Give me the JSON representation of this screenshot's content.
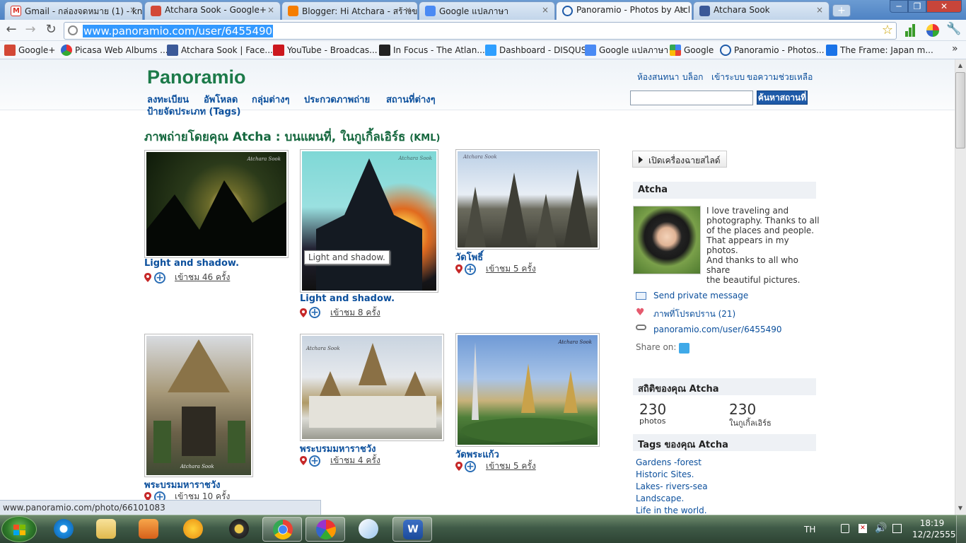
{
  "browser": {
    "tabs": [
      {
        "label": "Gmail - กล่องจดหมาย (1) - kn",
        "icon": "gmail-icon",
        "color": "#d93025"
      },
      {
        "label": "Atchara Sook - Google+",
        "icon": "google-plus-icon",
        "color": "#d34836"
      },
      {
        "label": "Blogger: Hi Atchara - สร้างข",
        "icon": "blogger-icon",
        "color": "#f57d00"
      },
      {
        "label": "Google แปลภาษา",
        "icon": "google-translate-icon",
        "color": "#4a8af4"
      },
      {
        "label": "Panoramio - Photos by Atcl",
        "icon": "panoramio-icon",
        "color": "#1e5aa8"
      },
      {
        "label": "Atchara Sook",
        "icon": "facebook-icon",
        "color": "#3b5998"
      }
    ],
    "close_glyph": "×",
    "new_tab_glyph": "+",
    "window_controls": {
      "minimize": "─",
      "restore": "❐",
      "close": "✕"
    },
    "back_glyph": "←",
    "forward_glyph": "→",
    "reload_glyph": "↻",
    "address": "www.panoramio.com/user/6455490",
    "star_glyph": "☆",
    "wrench_glyph": "🔧",
    "bookmarks": [
      {
        "label": "Google+",
        "icon": "google-plus-icon",
        "color": "#d34836"
      },
      {
        "label": "Picasa Web Albums ...",
        "icon": "picasa-icon",
        "color": "#9b59b6"
      },
      {
        "label": "Atchara Sook | Face...",
        "icon": "facebook-icon",
        "color": "#3b5998"
      },
      {
        "label": "YouTube - Broadcas...",
        "icon": "youtube-icon",
        "color": "#cc181e"
      },
      {
        "label": "In Focus - The Atlan...",
        "icon": "atlantic-icon",
        "color": "#222222"
      },
      {
        "label": "Dashboard - DISQUS",
        "icon": "disqus-icon",
        "color": "#2e9fff"
      },
      {
        "label": "Google แปลภาษา",
        "icon": "google-translate-icon",
        "color": "#4a8af4"
      },
      {
        "label": "Google",
        "icon": "google-icon",
        "color": "#4285f4"
      },
      {
        "label": "Panoramio - Photos...",
        "icon": "panoramio-icon",
        "color": "#1e5aa8"
      },
      {
        "label": "The Frame: Japan m...",
        "icon": "frame-icon",
        "color": "#1a73e8"
      }
    ],
    "more_glyph": "»",
    "status_url": "www.panoramio.com/photo/66101083"
  },
  "site": {
    "logo": "Panoramio",
    "top_links": [
      "ห้องสนทนา",
      "บล็อก",
      "เข้าระบบ",
      "ขอความช่วยเหลือ"
    ],
    "nav": [
      "ลงทะเบียน",
      "อัพโหลด",
      "กลุ่มต่างๆ",
      "ประกวดภาพถ่าย",
      "สถานที่ต่างๆ"
    ],
    "nav_tags": "ป้ายจัดประเภท (Tags)",
    "search_placeholder": "",
    "search_button": "ค้นหาสถานที่"
  },
  "main": {
    "title_prefix": "ภาพถ่ายโดยคุณ Atcha : ",
    "title_links": "บนแผนที่, ในกูเกิ้ลเอิร์ธ",
    "title_kml": "(KML)",
    "watermark": "Atchara Sook",
    "tooltip": "Light and shadow.",
    "photos": [
      {
        "title": "Light and shadow.",
        "views": "เข้าชม 46 ครั้ง"
      },
      {
        "title": "Light and shadow.",
        "views": "เข้าชม 8 ครั้ง"
      },
      {
        "title": "วัดโพธิ์",
        "views": "เข้าชม 5 ครั้ง"
      },
      {
        "title": "พระบรมมหาราชวัง",
        "views": "เข้าชม 10 ครั้ง"
      },
      {
        "title": "พระบรมมหาราชวัง",
        "views": "เข้าชม 4 ครั้ง"
      },
      {
        "title": "วัดพระแก้ว",
        "views": "เข้าชม 5 ครั้ง"
      }
    ]
  },
  "sidebar": {
    "slideshow": "เปิดเครื่องฉายสไลด์",
    "user_name": "Atcha",
    "bio": [
      "I love traveling and",
      "photography. Thanks to all",
      "of the places and people.",
      "That appears in my photos.",
      "And thanks to all who share",
      "the beautiful pictures."
    ],
    "send_message": "Send private message",
    "favorites": "ภาพที่โปรดปราน (21)",
    "profile_url": "panoramio.com/user/6455490",
    "share_on": "Share on:",
    "stats_title": "สถิติของคุณ Atcha",
    "stats": [
      {
        "value": "230",
        "label": "photos"
      },
      {
        "value": "230",
        "label": "ในกูเกิ้ลเอิร์ธ"
      }
    ],
    "tags_title": "Tags ของคุณ Atcha",
    "tags": [
      "Gardens -forest",
      "Historic Sites.",
      "Lakes- rivers-sea",
      "Landscape.",
      "Life in the world."
    ]
  },
  "taskbar": {
    "lang": "TH",
    "time": "18:19",
    "date": "12/2/2555",
    "apps": [
      "windows-start-icon",
      "internet-explorer-icon",
      "file-explorer-icon",
      "media-player-icon",
      "messenger-icon",
      "media-center-icon",
      "chrome-icon",
      "picasa-icon",
      "paint-icon",
      "word-icon"
    ]
  }
}
